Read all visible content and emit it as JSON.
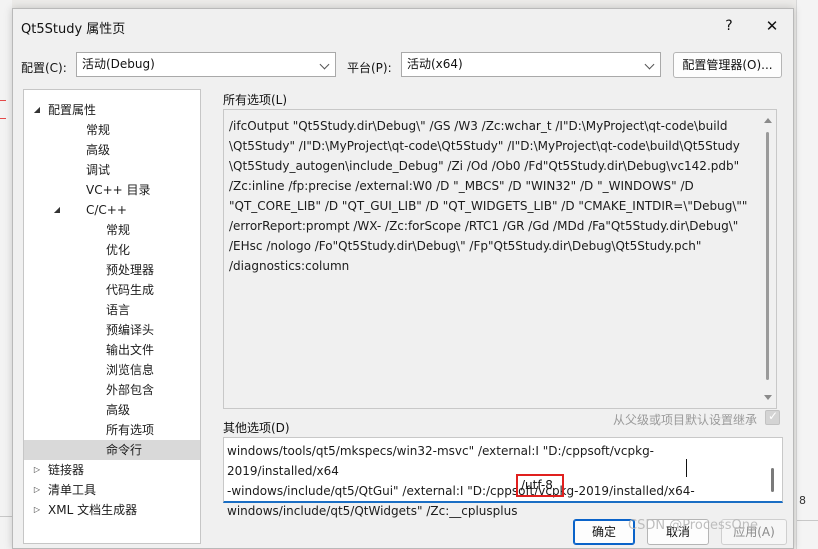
{
  "window": {
    "title": "Qt5Study 属性页",
    "help_glyph": "?",
    "close_glyph": "✕"
  },
  "config_row": {
    "config_label": "配置(C):",
    "config_value": "活动(Debug)",
    "platform_label": "平台(P):",
    "platform_value": "活动(x64)",
    "manager_button": "配置管理器(O)..."
  },
  "tree": {
    "items": [
      {
        "label": "配置属性",
        "expander": "◢"
      },
      {
        "label": "常规"
      },
      {
        "label": "高级"
      },
      {
        "label": "调试"
      },
      {
        "label": "VC++ 目录"
      },
      {
        "label": "C/C++",
        "expander": "◢"
      },
      {
        "label": "常规"
      },
      {
        "label": "优化"
      },
      {
        "label": "预处理器"
      },
      {
        "label": "代码生成"
      },
      {
        "label": "语言"
      },
      {
        "label": "预编译头"
      },
      {
        "label": "输出文件"
      },
      {
        "label": "浏览信息"
      },
      {
        "label": "外部包含"
      },
      {
        "label": "高级"
      },
      {
        "label": "所有选项"
      },
      {
        "label": "命令行",
        "selected": true
      },
      {
        "label": "链接器",
        "expander": "▷"
      },
      {
        "label": "清单工具",
        "expander": "▷"
      },
      {
        "label": "XML 文档生成器",
        "expander": "▷"
      }
    ]
  },
  "all_options": {
    "label": "所有选项(L)",
    "text": "/ifcOutput \"Qt5Study.dir\\Debug\\\" /GS /W3 /Zc:wchar_t /I\"D:\\MyProject\\qt-code\\build\n\\Qt5Study\" /I\"D:\\MyProject\\qt-code\\Qt5Study\" /I\"D:\\MyProject\\qt-code\\build\\Qt5Study\n\\Qt5Study_autogen\\include_Debug\" /Zi /Od /Ob0 /Fd\"Qt5Study.dir\\Debug\\vc142.pdb\"\n/Zc:inline /fp:precise /external:W0 /D \"_MBCS\" /D \"WIN32\" /D \"_WINDOWS\" /D\n\"QT_CORE_LIB\" /D \"QT_GUI_LIB\" /D \"QT_WIDGETS_LIB\" /D \"CMAKE_INTDIR=\\\"Debug\\\"\"\n/errorReport:prompt /WX- /Zc:forScope /RTC1 /GR /Gd /MDd /Fa\"Qt5Study.dir\\Debug\\\"\n/EHsc /nologo /Fo\"Qt5Study.dir\\Debug\\\" /Fp\"Qt5Study.dir\\Debug\\Qt5Study.pch\"\n/diagnostics:column"
  },
  "other_options": {
    "label": "其他选项(D)",
    "inherit_label": "从父级或项目默认设置继承",
    "text": "windows/tools/qt5/mkspecs/win32-msvc\" /external:I \"D:/cppsoft/vcpkg-2019/installed/x64\n-windows/include/qt5/QtGui\" /external:I \"D:/cppsoft/vcpkg-2019/installed/x64-\nwindows/include/qt5/QtWidgets\" /Zc:__cplusplus",
    "highlighted": "/utf-8"
  },
  "buttons": {
    "ok": "确定",
    "cancel": "取消",
    "apply": "应用(A)"
  },
  "watermark": "CSDN @ProcessOne",
  "background": {
    "side_number": "8"
  },
  "colors": {
    "accent": "#0a63c9",
    "highlight_box": "#e0201e",
    "selection": "#d9d9d9"
  }
}
